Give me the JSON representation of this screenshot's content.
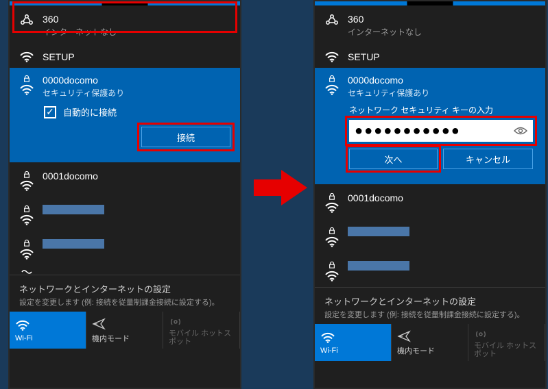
{
  "networks": {
    "n360": {
      "name": "360",
      "sub": "インターネットなし"
    },
    "setup": {
      "name": "SETUP"
    },
    "docomo0000": {
      "name": "0000docomo",
      "sub": "セキュリティ保護あり"
    },
    "docomo0001": {
      "name": "0001docomo"
    }
  },
  "left": {
    "auto_connect_label": "自動的に接続",
    "connect_label": "接続"
  },
  "right": {
    "key_label": "ネットワーク セキュリティ キーの入力",
    "key_masked": "●●●●●●●●●●●",
    "next_label": "次へ",
    "cancel_label": "キャンセル"
  },
  "settings": {
    "title": "ネットワークとインターネットの設定",
    "desc": "設定を変更します (例: 接続を従量制課金接続に設定する)。"
  },
  "footer": {
    "wifi": "Wi-Fi",
    "airplane": "機内モード",
    "hotspot": "モバイル ホットスポット"
  }
}
